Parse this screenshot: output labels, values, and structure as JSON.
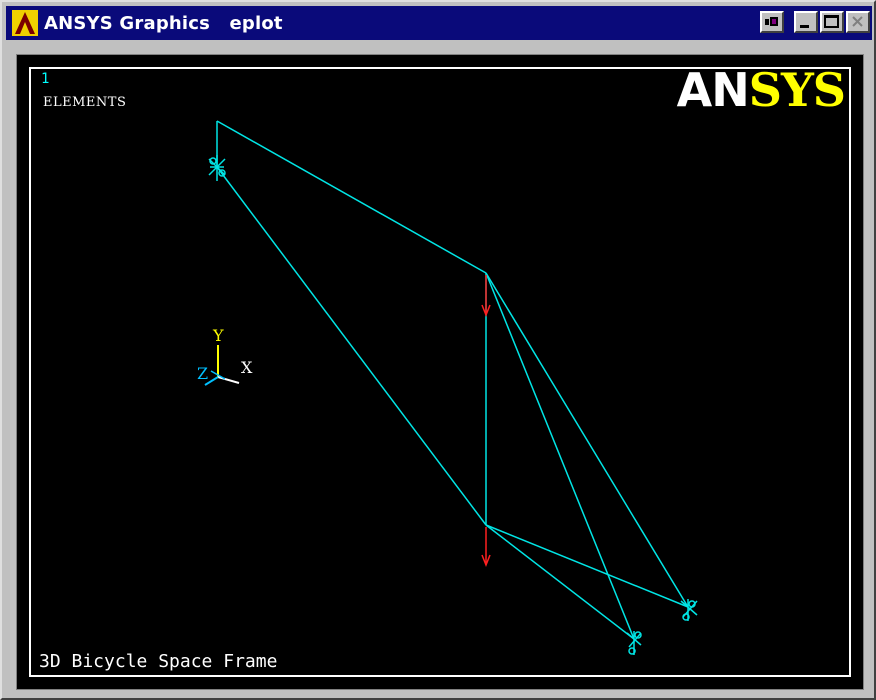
{
  "window": {
    "title": "ANSYS Graphics   eplot",
    "buttons": {
      "restore": "restore-toggle-icon",
      "minimize": "minimize-icon",
      "maximize": "maximize-icon",
      "close": "close-icon"
    }
  },
  "graphics": {
    "window_number": "1",
    "plot_type": "ELEMENTS",
    "brand_prefix": "AN",
    "brand_suffix": "SYS",
    "title": "3D Bicycle Space Frame",
    "triad": {
      "x": "X",
      "y": "Y",
      "z": "Z"
    },
    "colors": {
      "background": "#000000",
      "elements": "#00e5e5",
      "forces": "#ff2020",
      "triad_y": "#ffff00",
      "brand_suffix": "#ffff00"
    }
  }
}
